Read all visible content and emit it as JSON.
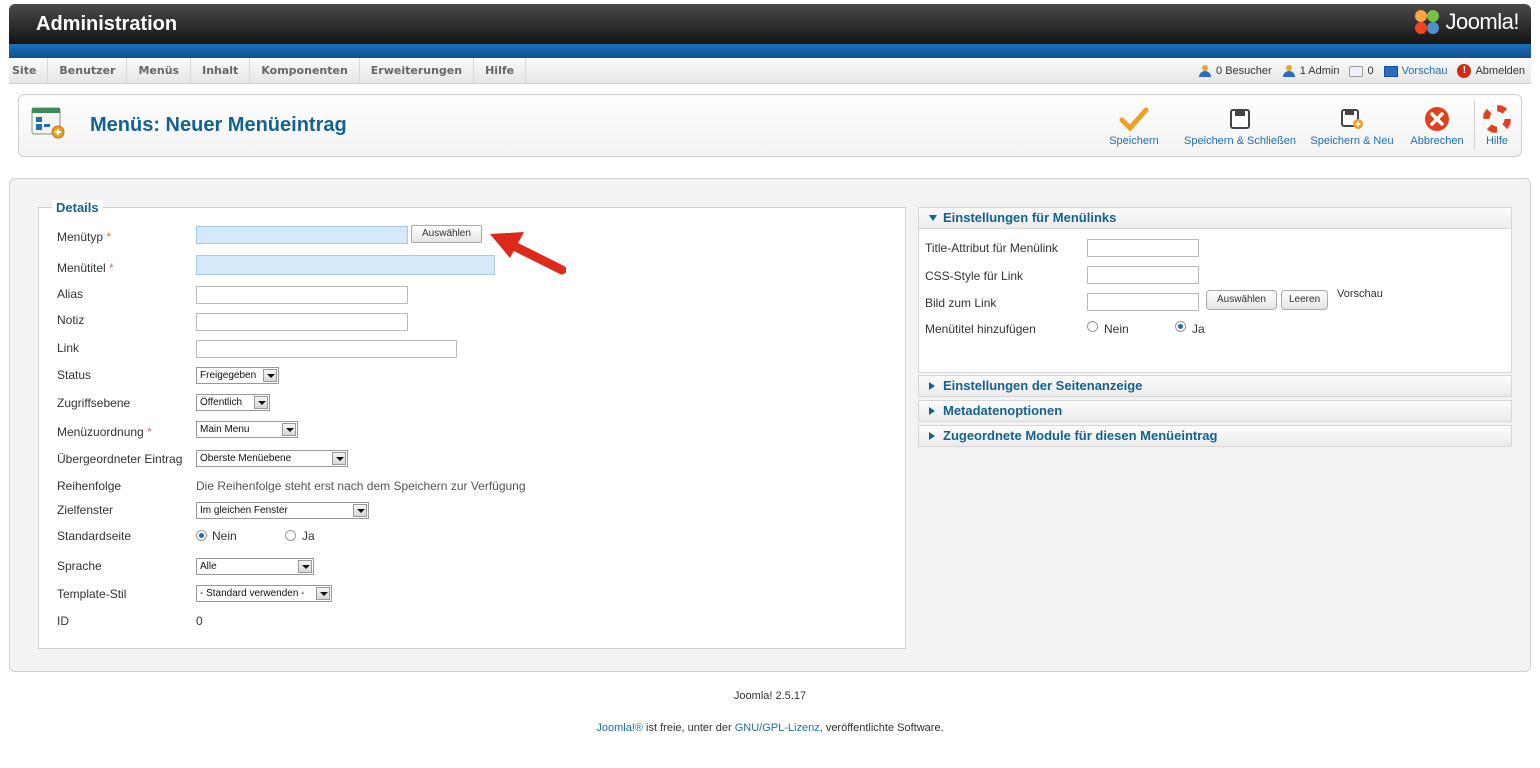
{
  "header": {
    "title": "Administration",
    "logo_text": "Joomla!"
  },
  "menu": {
    "items": [
      "Site",
      "Benutzer",
      "Menüs",
      "Inhalt",
      "Komponenten",
      "Erweiterungen",
      "Hilfe"
    ]
  },
  "status": {
    "visitors": "0 Besucher",
    "admins": "1 Admin",
    "messages": "0",
    "preview": "Vorschau",
    "logout": "Abmelden"
  },
  "toolbar": {
    "page_title": "Menüs: Neuer Menüeintrag",
    "save": "Speichern",
    "save_close": "Speichern & Schließen",
    "save_new": "Speichern & Neu",
    "cancel": "Abbrechen",
    "help": "Hilfe"
  },
  "details": {
    "legend": "Details",
    "menutype_label": "Menütyp",
    "required_mark": "*",
    "select_button": "Auswählen",
    "menutitle_label": "Menütitel",
    "alias_label": "Alias",
    "note_label": "Notiz",
    "link_label": "Link",
    "status_label": "Status",
    "status_value": "Freigegeben",
    "access_label": "Zugriffsebene",
    "access_value": "Öffentlich",
    "menu_assign_label": "Menüzuordnung",
    "menu_assign_value": "Main Menu",
    "parent_label": "Übergeordneter Eintrag",
    "parent_value": "Oberste Menüebene",
    "ordering_label": "Reihenfolge",
    "ordering_text": "Die Reihenfolge steht erst nach dem Speichern zur Verfügung",
    "target_label": "Zielfenster",
    "target_value": "Im gleichen Fenster",
    "default_label": "Standardseite",
    "no": "Nein",
    "yes": "Ja",
    "language_label": "Sprache",
    "language_value": "Alle",
    "template_label": "Template-Stil",
    "template_value": "- Standard verwenden -",
    "id_label": "ID",
    "id_value": "0"
  },
  "link_settings": {
    "heading": "Einstellungen für Menülinks",
    "title_attr_label": "Title-Attribut für Menülink",
    "css_label": "CSS-Style für Link",
    "image_label": "Bild zum Link",
    "select_button": "Auswählen",
    "clear_button": "Leeren",
    "preview_label": "Vorschau",
    "add_title_label": "Menütitel hinzufügen",
    "no": "Nein",
    "yes": "Ja"
  },
  "accordion": {
    "page_display": "Einstellungen der Seitenanzeige",
    "metadata": "Metadatenoptionen",
    "modules": "Zugeordnete Module für diesen Menüeintrag"
  },
  "footer": {
    "version": "Joomla! 2.5.17",
    "license_prefix": "Joomla!®",
    "license_mid": " ist freie, unter der ",
    "license_link": "GNU/GPL-Lizenz",
    "license_suffix": ", veröffentlichte Software."
  }
}
